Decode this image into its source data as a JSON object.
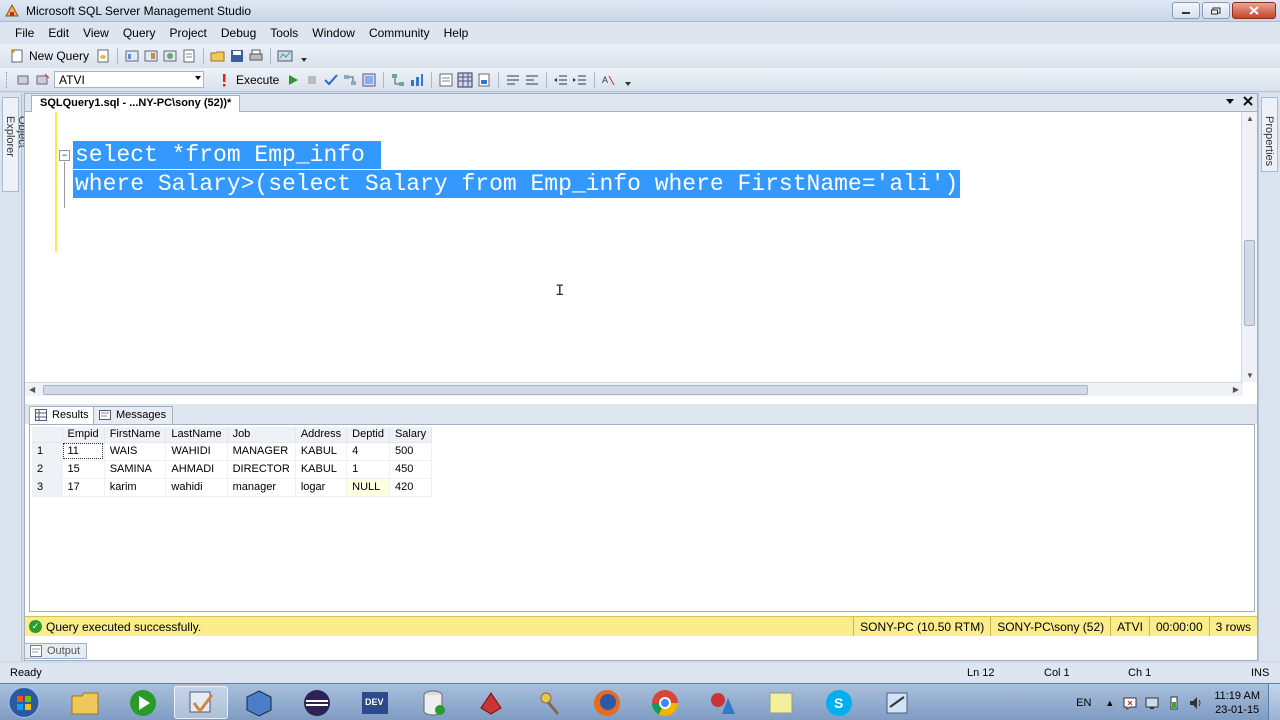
{
  "window": {
    "title": "Microsoft SQL Server Management Studio"
  },
  "menu": [
    "File",
    "Edit",
    "View",
    "Query",
    "Project",
    "Debug",
    "Tools",
    "Window",
    "Community",
    "Help"
  ],
  "toolbar": {
    "new_query": "New Query",
    "database": "ATVI",
    "execute": "Execute"
  },
  "side_panels": {
    "left": "Object Explorer",
    "right": "Properties"
  },
  "doc_tab": {
    "title": "SQLQuery1.sql - ...NY-PC\\sony (52))*"
  },
  "editor": {
    "lines": [
      "select *from Emp_info ",
      "where Salary>(select Salary from Emp_info where FirstName='ali')"
    ],
    "cursor": "I"
  },
  "results": {
    "tabs": [
      "Results",
      "Messages"
    ],
    "columns": [
      "Empid",
      "FirstName",
      "LastName",
      "Job",
      "Address",
      "Deptid",
      "Salary"
    ],
    "rows": [
      {
        "num": "1",
        "cells": [
          "11",
          "WAIS",
          "WAHIDI",
          "MANAGER",
          "KABUL",
          "4",
          "500"
        ]
      },
      {
        "num": "2",
        "cells": [
          "15",
          "SAMINA",
          "AHMADI",
          "DIRECTOR",
          "KABUL",
          "1",
          "450"
        ]
      },
      {
        "num": "3",
        "cells": [
          "17",
          "karim",
          "wahidi",
          "manager",
          "logar",
          "NULL",
          "420"
        ]
      }
    ]
  },
  "query_status": {
    "message": "Query executed successfully.",
    "server": "SONY-PC (10.50 RTM)",
    "user": "SONY-PC\\sony (52)",
    "database": "ATVI",
    "time": "00:00:00",
    "rows": "3 rows"
  },
  "output_tab": "Output",
  "status_bar": {
    "state": "Ready",
    "line": "Ln 12",
    "col": "Col 1",
    "ch": "Ch 1",
    "mode": "INS"
  },
  "taskbar": {
    "language": "EN",
    "time": "11:19 AM",
    "date": "23-01-15"
  }
}
